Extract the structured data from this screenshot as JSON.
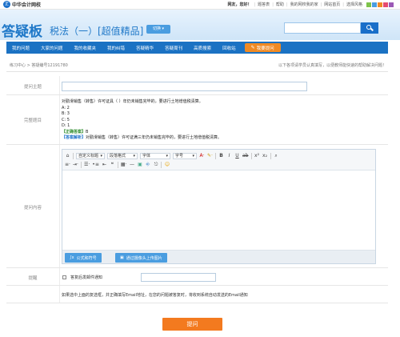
{
  "site": {
    "logo_text": "中华会计网校",
    "logo_mark": "正"
  },
  "toplinks": {
    "greeting": "网友，您好！",
    "items": [
      "题答表",
      "帮助",
      "我的网校我的家",
      "网站首页",
      "选择风格"
    ],
    "style_swatches": [
      "#7ec34a",
      "#4a9de0",
      "#f08a24",
      "#e64b6e",
      "#9b59b6"
    ]
  },
  "header": {
    "brand": "答疑板",
    "subject": "税法（一）[超值精品]",
    "switch_label": "切换"
  },
  "search": {
    "placeholder": ""
  },
  "nav": {
    "items": [
      "我的问题",
      "大家的问题",
      "我的收藏夹",
      "我的纠错",
      "答疑精华",
      "答疑周刊",
      "高质搜索",
      "回收站"
    ],
    "ask_label": "我要提问"
  },
  "breadcrumb": "练习中心 > 答疑编号12191780",
  "tip": "以下各项请学员认真填写，以便教师能快速的帮助解决问题！",
  "form": {
    "title_label": "提问主题",
    "title_value": "",
    "question_label": "完整题目",
    "question_lines": [
      "对勤滑销售（转售）许可证具（    ）年仍未销售完毕的，要进行土地增值税清算。",
      "A: 2",
      "B: 3",
      "C: 5",
      "D: 1"
    ],
    "answer_tag": "【正确答案】",
    "answer_value": "B",
    "explain_tag": "【答案解析】",
    "explain_text": "对勤滑销售（转售）许可证满三年仍未销售完毕的，要进行土地增值税清算。",
    "content_label": "提问内容",
    "notify_label": "提醒",
    "notify_text": "答复后发邮件通知",
    "email_value": "",
    "note": "如果选中上面的复选框，并正确填写Email地址，在您的问题被答复时，将收到系统自动发送的Email通知"
  },
  "editor": {
    "custom_title": "自定义标题",
    "paragraph": "段落格式",
    "font": "字体",
    "size": "字号",
    "formula_btn": "公式和符号",
    "upload_btn": "通过摄像头上传图片"
  },
  "submit_label": "提问"
}
